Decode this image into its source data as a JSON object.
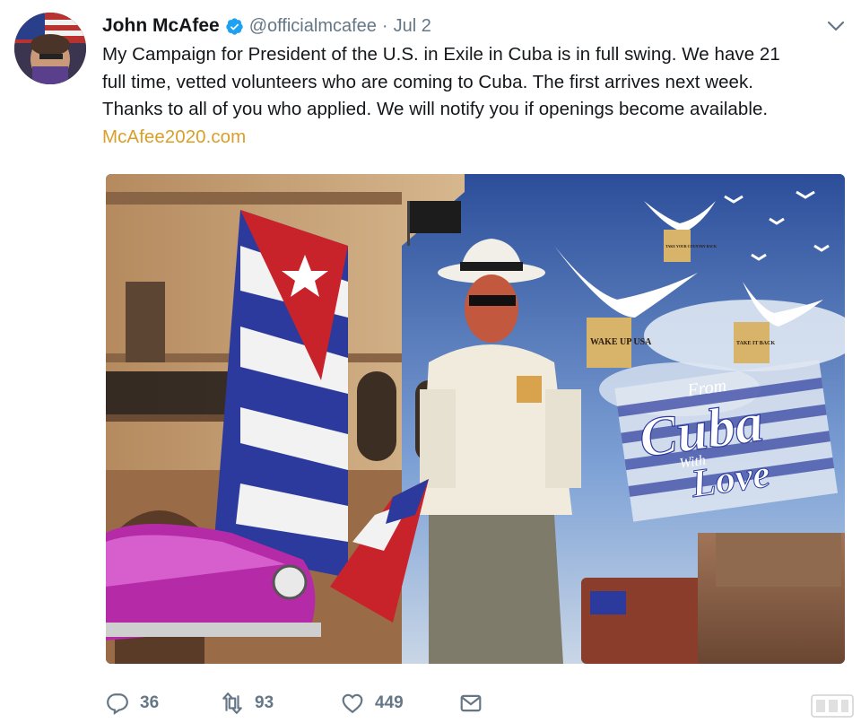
{
  "tweet": {
    "author": {
      "display_name": "John McAfee",
      "handle": "@officialmcafee",
      "verified_icon": "verified-badge-icon",
      "avatar_icon": "profile-avatar"
    },
    "separator": "·",
    "date": "Jul 2",
    "text_lines": [
      "My Campaign for President of the U.S. in Exile in Cuba is in full swing. We have 21",
      "full time, vetted volunteers who are coming to Cuba. The first arrives next week.",
      "Thanks to all of you who applied. We will notify you if openings become available."
    ],
    "link": "McAfee2020.com",
    "media": {
      "poster_lines": [
        "From",
        "Cuba",
        "With",
        "Love"
      ],
      "banner_texts": [
        "WAKE UP USA",
        "TAKE YOUR COUNTRY BACK",
        "TAKE IT BACK"
      ]
    },
    "actions": {
      "reply_count": "36",
      "retweet_count": "93",
      "like_count": "449",
      "reply_icon": "reply-icon",
      "retweet_icon": "retweet-icon",
      "like_icon": "heart-icon",
      "dm_icon": "envelope-icon"
    }
  },
  "colors": {
    "text": "#14171a",
    "secondary": "#657786",
    "link": "#d8a02a",
    "verified": "#1da1f2"
  }
}
